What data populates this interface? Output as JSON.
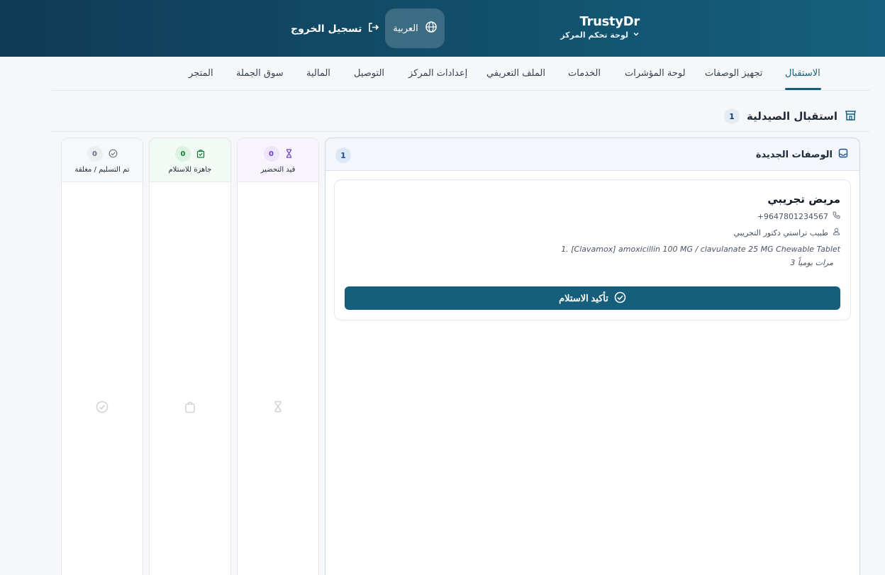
{
  "header": {
    "brand_name": "TrustyDr",
    "brand_subtitle": "لوحة تحكم المركز",
    "language": "العربية",
    "logout": "تسجيل الخروج"
  },
  "nav": {
    "items": [
      {
        "label": "الاستقبال",
        "active": true
      },
      {
        "label": "تجهيز الوصفات"
      },
      {
        "label": "لوحة المؤشرات"
      },
      {
        "label": "الخدمات"
      },
      {
        "label": "الملف التعريفي"
      },
      {
        "label": "إعدادات المركز"
      },
      {
        "label": "التوصيل"
      },
      {
        "label": "المالية"
      },
      {
        "label": "سوق الجملة"
      },
      {
        "label": "المتجر"
      }
    ]
  },
  "section": {
    "title": "استقبال الصيدلية",
    "count": "1"
  },
  "columns": {
    "new": {
      "title": "الوصفات الجديدة",
      "count": "1",
      "card": {
        "patient": "مريض تجريبي",
        "phone": "+9647801234567",
        "doctor": "طبيب تراستي دكتور التجريبي",
        "medication": "1. [Clavamox] amoxicillin 100 MG / clavulanate 25 MG Chewable Tablet",
        "dosage": "3 مرات يومياً",
        "confirm": "تأكيد الاستلام"
      }
    },
    "preparing": {
      "label": "قيد التحضير",
      "count": "0"
    },
    "ready": {
      "label": "جاهزة للاستلام",
      "count": "0"
    },
    "done": {
      "label": "تم التسليم / مغلقة",
      "count": "0"
    }
  },
  "colors": {
    "primary": "#155e7c",
    "header_dark": "#0f3b55",
    "preparing_accent": "#6d3fd0",
    "ready_accent": "#15803d",
    "done_accent": "#6b7280"
  }
}
